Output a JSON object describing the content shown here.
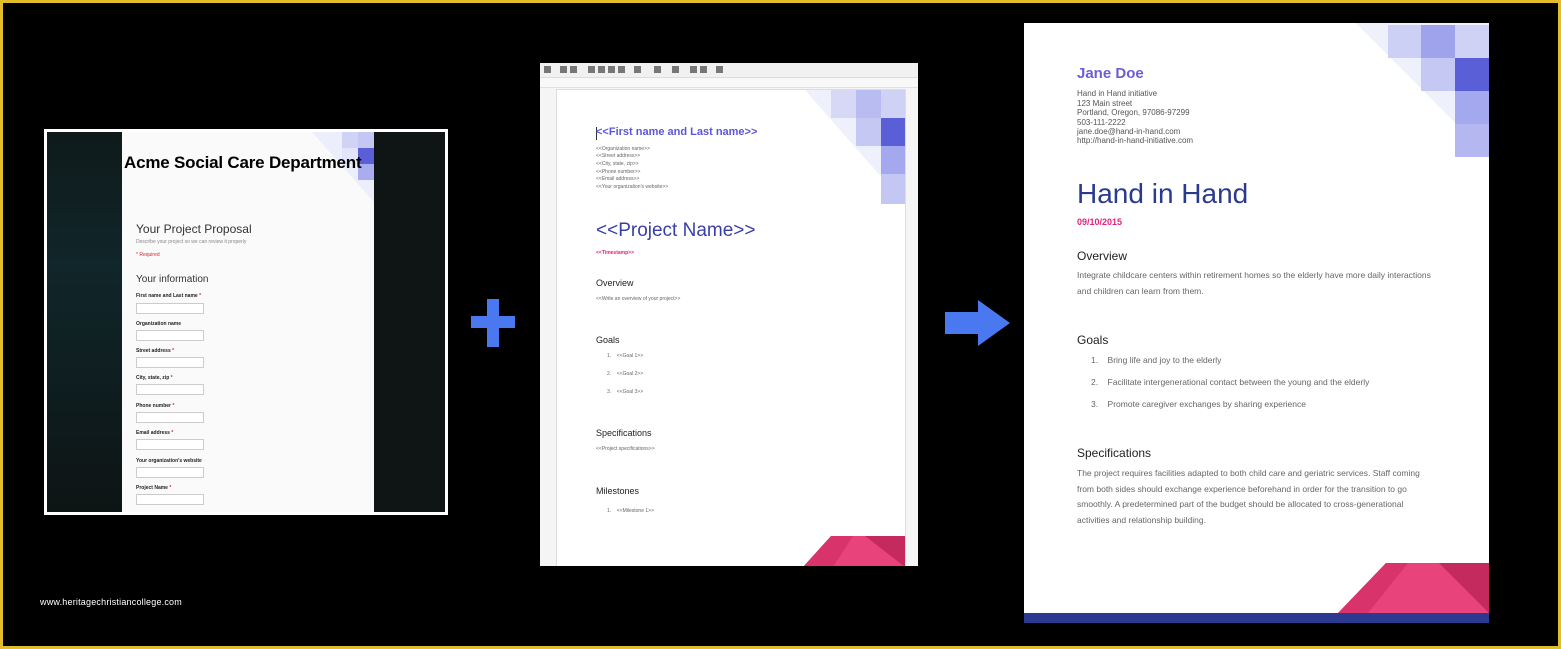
{
  "form": {
    "banner_title": "Acme Social Care Department",
    "title": "Your Project Proposal",
    "description": "Describe your project so we can review it properly",
    "required_note": "* Required",
    "section": "Your information",
    "fields": [
      {
        "label": "First name and Last name",
        "required": "*"
      },
      {
        "label": "Organization name",
        "required": ""
      },
      {
        "label": "Street address",
        "required": "*"
      },
      {
        "label": "City, state, zip",
        "required": "*"
      },
      {
        "label": "Phone number",
        "required": "*"
      },
      {
        "label": "Email address",
        "required": "*"
      },
      {
        "label": "Your organization's website",
        "required": ""
      },
      {
        "label": "Project Name",
        "required": "*"
      }
    ]
  },
  "template": {
    "name": "<<First name and Last name>>",
    "org_lines": [
      "<<Organization name>>",
      "<<Street address>>",
      "<<City, state, zip>>",
      "<<Phone number>>",
      "<<Email address>>",
      "<<Your organization's website>>"
    ],
    "project": "<<Project Name>>",
    "timestamp": "<<Timestamp>>",
    "overview_heading": "Overview",
    "overview_text": "<<Write an overview of your project>>",
    "goals_heading": "Goals",
    "goals": [
      "<<Goal 1>>",
      "<<Goal 2>>",
      "<<Goal 3>>"
    ],
    "specs_heading": "Specifications",
    "specs_text": "<<Project specifications>>",
    "milestones_heading": "Milestones",
    "milestones": [
      "<<Milestone 1>>"
    ]
  },
  "final": {
    "name": "Jane Doe",
    "contact_lines": [
      "Hand in Hand initiative",
      "123 Main street",
      "Portland, Oregon, 97086-97299",
      "503-111-2222",
      "jane.doe@hand-in-hand.com",
      "http://hand-in-hand-initiative.com"
    ],
    "project": "Hand in Hand",
    "date": "09/10/2015",
    "overview_heading": "Overview",
    "overview_text": "Integrate childcare centers within retirement homes so the elderly have more daily interactions and children can learn from them.",
    "goals_heading": "Goals",
    "goals": [
      "Bring life and joy to the elderly",
      "Facilitate intergenerational contact between the young and the elderly",
      "Promote caregiver exchanges by sharing experience"
    ],
    "specs_heading": "Specifications",
    "specs_text": "The project requires facilities adapted to both child care and geriatric services. Staff coming from both sides should exchange experience beforehand in order for the transition to go smoothly. A predetermined part of the budget should be allocated to cross-generational activities and relationship building."
  },
  "watermark": "www.heritagechristiancollege.com",
  "colors": {
    "accent_blue": "#4a78f0",
    "title_purple": "#6a5fd2",
    "heading_navy": "#2a3a8f",
    "date_pink": "#e0247c",
    "frame_gold": "#e2bd2b"
  },
  "icons": [
    "plus-icon",
    "right-arrow-icon"
  ]
}
